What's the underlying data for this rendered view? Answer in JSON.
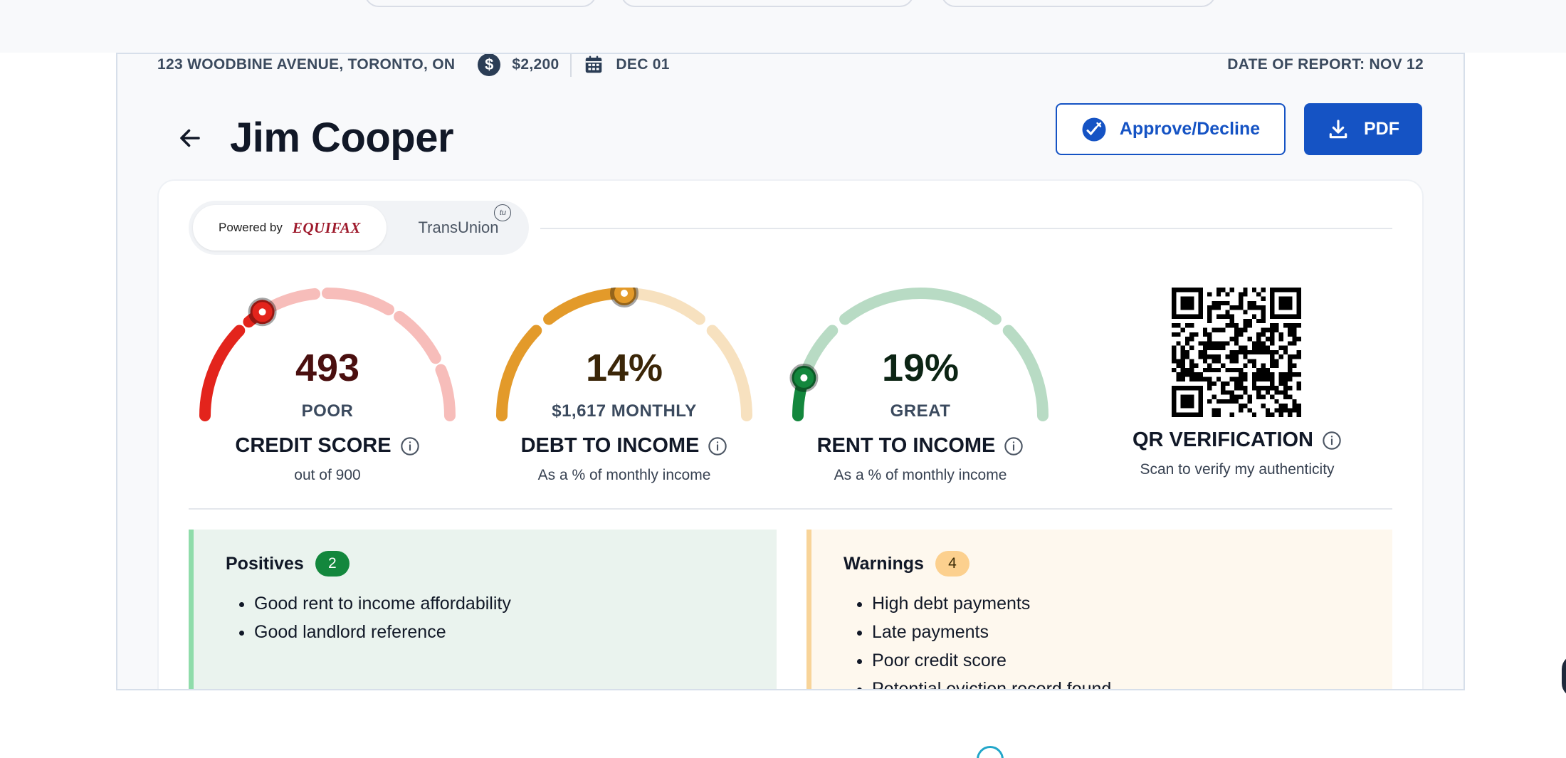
{
  "report_meta": {
    "address": "123 WOODBINE AVENUE, TORONTO, ON",
    "rent": "$2,200",
    "move_in": "DEC 01",
    "report_date": "DATE OF REPORT: NOV 12",
    "dollar_glyph": "$"
  },
  "header": {
    "name": "Jim Cooper",
    "approve_label": "Approve/Decline",
    "pdf_label": "PDF"
  },
  "provider": {
    "powered_by": "Powered by",
    "equifax": "EQUIFAX",
    "transunion": "TransUnion",
    "tu_mark": "tu",
    "active": "equifax"
  },
  "metrics": {
    "credit_score": {
      "value": "493",
      "rating": "POOR",
      "title": "CREDIT SCORE",
      "caption": "out of 900",
      "score": 493,
      "max": 900,
      "color": "#e3241c",
      "value_color": "#4a0f0f"
    },
    "debt_to_income": {
      "value": "14%",
      "rating": "$1,617 MONTHLY",
      "title": "DEBT TO INCOME",
      "caption": "As a % of monthly income",
      "percent": 14,
      "color": "#e39a2a",
      "value_color": "#3b2608"
    },
    "rent_to_income": {
      "value": "19%",
      "rating": "GREAT",
      "title": "RENT TO INCOME",
      "caption": "As a % of monthly income",
      "percent": 19,
      "color": "#13873d",
      "value_color": "#0c2414"
    }
  },
  "qr": {
    "title": "QR VERIFICATION",
    "caption": "Scan to verify my authenticity"
  },
  "positives": {
    "title": "Positives",
    "count": "2",
    "items": [
      "Good rent to income affordability",
      "Good landlord reference"
    ]
  },
  "warnings": {
    "title": "Warnings",
    "count": "4",
    "items": [
      "High debt payments",
      "Late payments",
      "Poor credit score",
      "Potential eviction record found"
    ]
  },
  "colors": {
    "primary": "#1553c4",
    "positive": "#13873d",
    "warning": "#fcd08e"
  }
}
